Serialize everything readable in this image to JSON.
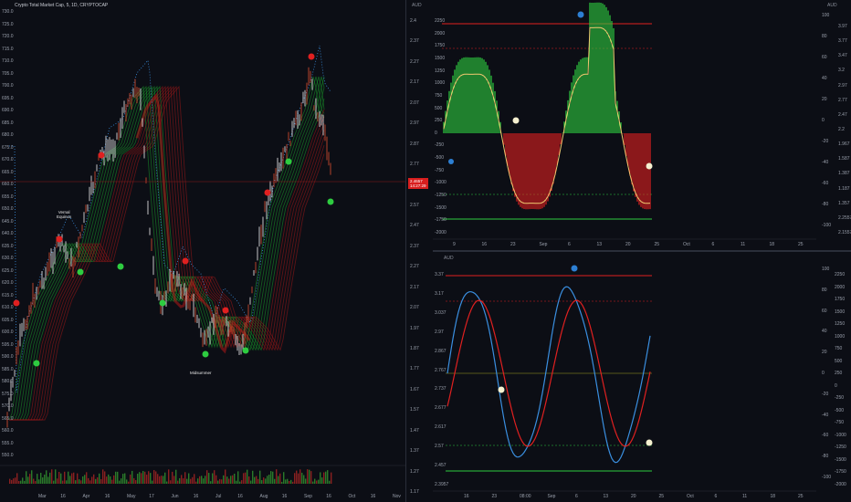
{
  "main_chart": {
    "title": "Crypto Total Market Cap, 5, 1D, CRYPTOCAP",
    "price_tag": [
      "2.4657",
      "14:27:29"
    ],
    "y_ticks": [
      "730.0",
      "725.0",
      "720.0",
      "715.0",
      "710.0",
      "705.0",
      "700.0",
      "695.0",
      "690.0",
      "685.0",
      "680.0",
      "675.0",
      "670.0",
      "665.0",
      "660.0",
      "655.0",
      "650.0",
      "645.0",
      "640.0",
      "635.0",
      "630.0",
      "625.0",
      "620.0",
      "615.0",
      "610.0",
      "605.0",
      "600.0",
      "595.0",
      "590.0",
      "585.0",
      "580.0",
      "575.0",
      "570.0",
      "565.0",
      "560.0",
      "555.0",
      "550.0"
    ],
    "right_ticks": [
      "2.4",
      "2.37",
      "2.27",
      "2.17",
      "2.07",
      "2.97",
      "2.87",
      "2.77",
      "2.67",
      "2.57",
      "2.47",
      "2.37",
      "2.27",
      "2.17",
      "2.07",
      "1.97",
      "1.87",
      "1.77",
      "1.67",
      "1.57",
      "1.47",
      "1.37",
      "1.27",
      "1.17"
    ],
    "x_ticks": [
      "Mar",
      "16",
      "Apr",
      "16",
      "May",
      "17",
      "Jun",
      "16",
      "Jul",
      "16",
      "Aug",
      "16",
      "Sep",
      "16",
      "Oct",
      "16",
      "Nov"
    ],
    "annotations": [
      {
        "label": "Vernal",
        "sub": "Equinox"
      },
      {
        "label": "Midsummer",
        "sub": ""
      }
    ],
    "unit": "AUD"
  },
  "top_right": {
    "unit": "AUD",
    "left_ticks": [
      "2250",
      "2000",
      "1750",
      "1500",
      "1250",
      "1000",
      "750",
      "500",
      "250",
      "0",
      "-250",
      "-500",
      "-750",
      "-1000",
      "-1250",
      "-1500",
      "-1750",
      "-2000"
    ],
    "right_ticks": [
      "100",
      "80",
      "60",
      "40",
      "20",
      "0",
      "-20",
      "-40",
      "-60",
      "-80",
      "-100"
    ],
    "far_right": [
      "3.97",
      "3.77",
      "3.47",
      "3.2",
      "2.97",
      "2.77",
      "2.47",
      "2.2",
      "1.967",
      "1.587",
      "1.387",
      "1.187",
      "1.357",
      "2.2557",
      "2.1557"
    ],
    "x_ticks": [
      "9",
      "16",
      "23",
      "Sep",
      "6",
      "13",
      "20",
      "25",
      "Oct",
      "6",
      "11",
      "18",
      "25"
    ]
  },
  "bottom_right": {
    "unit": "AUD",
    "left_ticks": [
      "3.37",
      "3.17",
      "3.037",
      "2.97",
      "2.867",
      "2.767",
      "2.737",
      "2.677",
      "2.617",
      "2.57",
      "2.457",
      "2.3957"
    ],
    "right_ticks": [
      "100",
      "80",
      "60",
      "40",
      "20",
      "0",
      "-20",
      "-40",
      "-60",
      "-80",
      "-100"
    ],
    "far_right": [
      "2250",
      "2000",
      "1750",
      "1500",
      "1250",
      "1000",
      "750",
      "500",
      "250",
      "0",
      "-250",
      "-500",
      "-750",
      "-1000",
      "-1250",
      "-1500",
      "-1750",
      "-2000"
    ],
    "x_ticks": [
      "16",
      "23",
      "08:00",
      "Sep",
      "6",
      "13",
      "20",
      "25",
      "Oct",
      "6",
      "11",
      "18",
      "25"
    ]
  },
  "colors": {
    "background": "#0c0e15",
    "bull": "#2ecc40",
    "bear": "#e02020",
    "accent_blue": "#2d7fd3",
    "signal_yellow": "#f0d080",
    "price": "#f2f2f2"
  }
}
